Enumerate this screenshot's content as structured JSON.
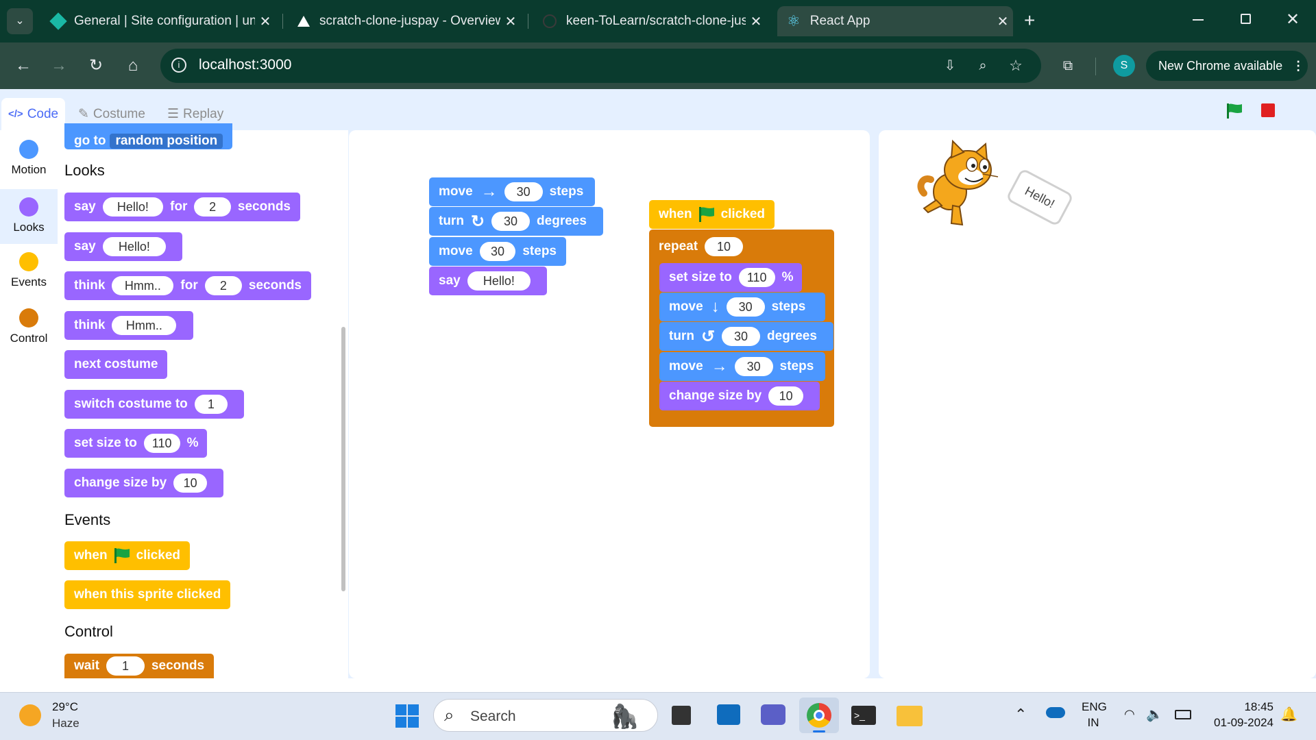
{
  "browser": {
    "tabs": [
      {
        "title": "General | Site configuration | un"
      },
      {
        "title": "scratch-clone-juspay - Overview"
      },
      {
        "title": "keen-ToLearn/scratch-clone-jus"
      },
      {
        "title": "React App"
      }
    ],
    "url": "localhost:3000",
    "profile_initial": "S",
    "update_label": "New Chrome available"
  },
  "app": {
    "tabs": [
      {
        "label": "Code"
      },
      {
        "label": "Costume"
      },
      {
        "label": "Replay"
      }
    ],
    "categories": [
      {
        "label": "Motion",
        "color": "#4c97ff"
      },
      {
        "label": "Looks",
        "color": "#9966ff"
      },
      {
        "label": "Events",
        "color": "#ffbf00"
      },
      {
        "label": "Control",
        "color": "#d97b0a"
      }
    ],
    "palette": {
      "motion_partial": {
        "label": "go to",
        "value": "random position"
      },
      "looks_header": "Looks",
      "say_for": {
        "say": "say",
        "value": "Hello!",
        "for": "for",
        "secs": "2",
        "unit": "seconds"
      },
      "say": {
        "say": "say",
        "value": "Hello!"
      },
      "think_for": {
        "think": "think",
        "value": "Hmm..",
        "for": "for",
        "secs": "2",
        "unit": "seconds"
      },
      "think": {
        "think": "think",
        "value": "Hmm.."
      },
      "next_costume": "next costume",
      "switch_costume": {
        "label": "switch costume to",
        "value": "1"
      },
      "set_size": {
        "label": "set size to",
        "value": "110",
        "unit": "%"
      },
      "change_size": {
        "label": "change size by",
        "value": "10"
      },
      "events_header": "Events",
      "when_flag": {
        "when": "when",
        "clicked": "clicked"
      },
      "when_sprite": "when this sprite clicked",
      "control_header": "Control",
      "wait": {
        "label": "wait",
        "value": "1",
        "unit": "seconds"
      }
    },
    "script1": {
      "move1": {
        "label": "move",
        "value": "30",
        "unit": "steps"
      },
      "turn": {
        "label": "turn",
        "value": "30",
        "unit": "degrees"
      },
      "move2": {
        "label": "move",
        "value": "30",
        "unit": "steps"
      },
      "say": {
        "label": "say",
        "value": "Hello!"
      }
    },
    "script2": {
      "hat": {
        "when": "when",
        "clicked": "clicked"
      },
      "repeat": {
        "label": "repeat",
        "value": "10"
      },
      "set_size": {
        "label": "set size to",
        "value": "110",
        "unit": "%"
      },
      "move_down": {
        "label": "move",
        "value": "30",
        "unit": "steps"
      },
      "turn_ccw": {
        "label": "turn",
        "value": "30",
        "unit": "degrees"
      },
      "move_right": {
        "label": "move",
        "value": "30",
        "unit": "steps"
      },
      "change_size": {
        "label": "change size by",
        "value": "10"
      }
    },
    "stage": {
      "speech": "Hello!"
    }
  },
  "taskbar": {
    "weather_temp": "29°C",
    "weather_desc": "Haze",
    "search_placeholder": "Search",
    "lang_top": "ENG",
    "lang_bottom": "IN",
    "time": "18:45",
    "date": "01-09-2024"
  }
}
